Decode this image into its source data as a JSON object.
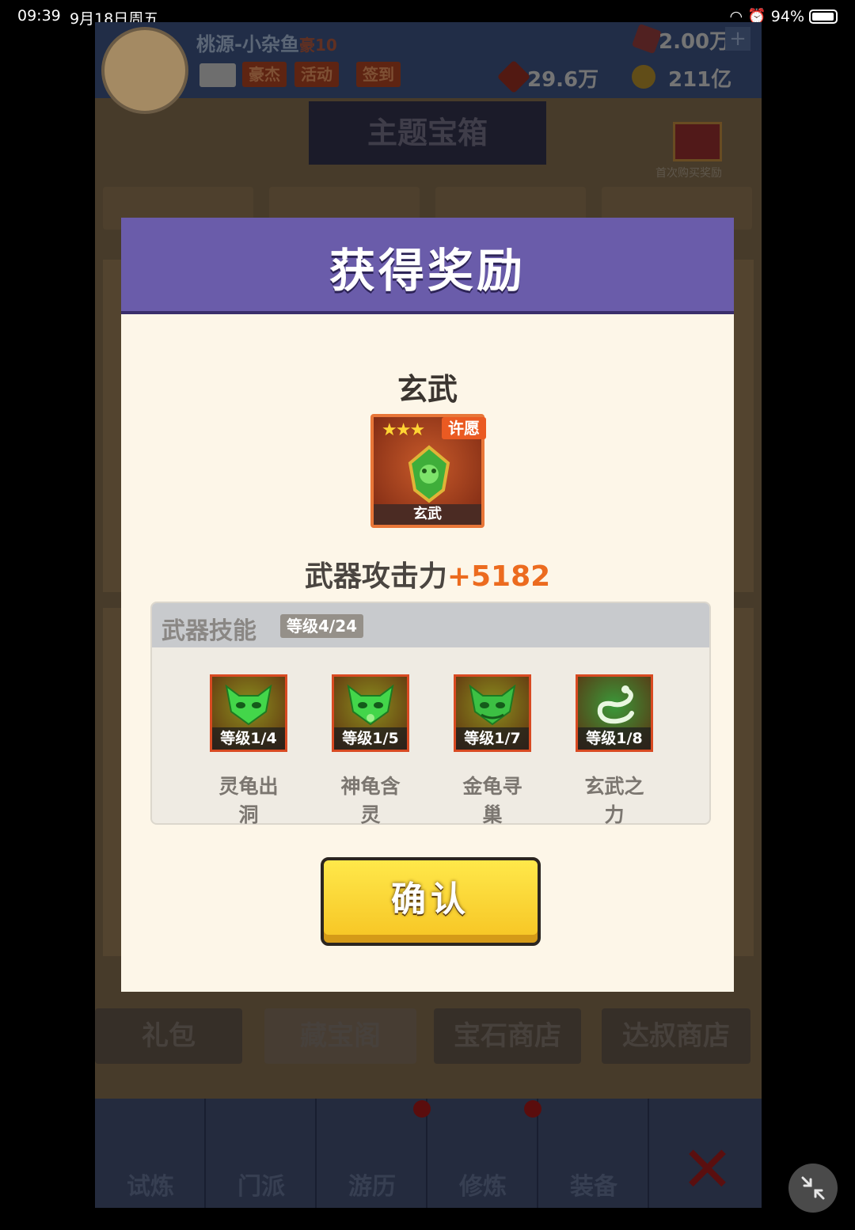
{
  "status_bar": {
    "time": "09:39",
    "date": "9月18日周五",
    "battery": "94%"
  },
  "game_bg": {
    "player_name": "桃源-小杂鱼",
    "vip": "豪10",
    "chips": [
      "豪杰",
      "活动",
      "签到"
    ],
    "gems": "2.00万",
    "red_currency": "29.6万",
    "gold": "211亿",
    "banner_title": "主题宝箱",
    "chest_label": "首次购买奖励",
    "shop_tabs": [
      "礼包",
      "藏宝阁",
      "宝石商店",
      "达叔商店"
    ],
    "nav": [
      "试炼",
      "门派",
      "游历",
      "修炼",
      "装备"
    ]
  },
  "modal": {
    "title": "获得奖励",
    "item_name": "玄武",
    "item_stars": "★★★",
    "item_badge": "许愿",
    "item_label": "玄武",
    "attack_label": "武器攻击力",
    "attack_value": "+5182",
    "skills_title": "武器技能",
    "skills_level": "等级4/24",
    "skills": [
      {
        "level": "等级1/4",
        "name": "灵龟出洞",
        "icon": "turtle-mask-icon"
      },
      {
        "level": "等级1/5",
        "name": "神龟含灵",
        "icon": "turtle-mask-icon"
      },
      {
        "level": "等级1/7",
        "name": "金龟寻巢",
        "icon": "turtle-mask-icon"
      },
      {
        "level": "等级1/8",
        "name": "玄武之力",
        "icon": "serpent-icon"
      }
    ],
    "confirm": "确认"
  },
  "colors": {
    "modal_header": "#6a5caa",
    "attack_value": "#ec6b1f",
    "confirm_button": "#f6c423"
  }
}
